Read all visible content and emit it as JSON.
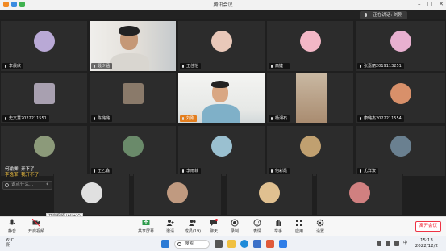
{
  "window": {
    "title": "腾讯会议",
    "controls": [
      "–",
      "□",
      "✕"
    ]
  },
  "speaking_banner": "正在讲话: 刘刚",
  "tiles": [
    {
      "name": "李晨欣",
      "avatar_color": "#b9a9d6"
    },
    {
      "name": "聂少涵",
      "avatar_color": "#d9c8b0"
    },
    {
      "name": "王佳怡",
      "avatar_color": "#e9c8b9"
    },
    {
      "name": "高婕一",
      "avatar_color": "#f3b7c6"
    },
    {
      "name": "张嘉丽2019113251",
      "avatar_color": "#e8b0d0"
    },
    {
      "name": "史文慧2022211551",
      "avatar_color": "#a8a0b0"
    },
    {
      "name": "陈璐璐",
      "avatar_color": "#8a7a6a"
    },
    {
      "name": "刘刚",
      "avatar_color": "#ffffff"
    },
    {
      "name": "杨湘石",
      "avatar_color": "#c09070"
    },
    {
      "name": "康璐杰2022211554",
      "avatar_color": "#d8906a"
    },
    {
      "name": "",
      "avatar_color": "#8c9a7a"
    },
    {
      "name": "王乙鑫",
      "avatar_color": "#6a8a6a"
    },
    {
      "name": "李雨菲",
      "avatar_color": "#9ac0d0"
    },
    {
      "name": "何彩霞",
      "avatar_color": "#c0a070"
    },
    {
      "name": "尤洋汝",
      "avatar_color": "#6a8090"
    },
    {
      "name": "",
      "avatar_color": "#e0e0e0"
    },
    {
      "name": "",
      "avatar_color": "#c09a80"
    },
    {
      "name": "",
      "avatar_color": "#e0c090"
    },
    {
      "name": "",
      "avatar_color": "#d08080"
    }
  ],
  "chat": {
    "line1": "开不了",
    "line1_prefix": "何瑜卿:",
    "line2": "李逸军: 我开不了",
    "input_placeholder": "说点什么..."
  },
  "tooltip": "开启视频 (Alt+V)",
  "toolbar": {
    "mute": "静音",
    "video": "开启视频",
    "share": "共享屏幕",
    "invite": "邀请",
    "members": "成员(19)",
    "chat": "聊天",
    "record": "录制",
    "react": "表情",
    "hand": "举手",
    "apps": "应用",
    "settings": "设置",
    "end": "离开会议"
  },
  "taskbar": {
    "weather_temp": "6°C",
    "weather_desc": "阴",
    "search": "搜索",
    "time": "15:13",
    "date": "2022/12/2",
    "lang": "中"
  },
  "colors": {
    "accent_orange": "#e37e1f",
    "end_red": "#e23"
  }
}
